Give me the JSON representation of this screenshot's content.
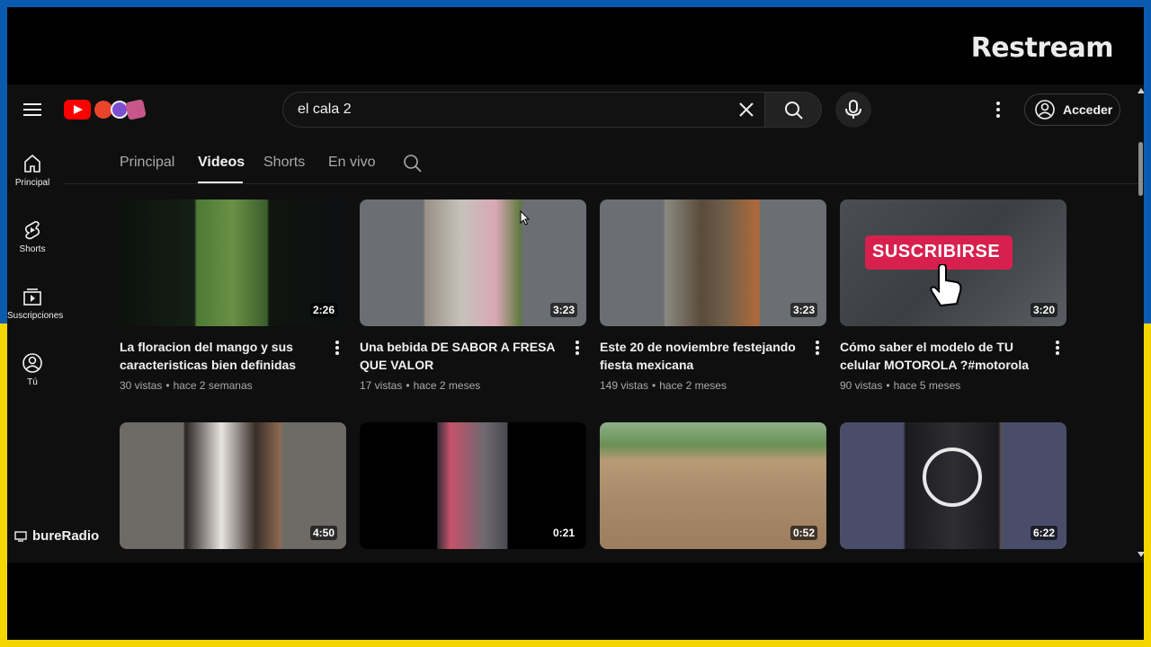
{
  "branding": {
    "restream": "Restream",
    "channel_watermark": "bureRadio"
  },
  "header": {
    "search_query": "el cala 2",
    "signin_label": "Acceder"
  },
  "sidebar": {
    "items": [
      {
        "label": "Principal",
        "icon": "home-icon"
      },
      {
        "label": "Shorts",
        "icon": "shorts-icon"
      },
      {
        "label": "Suscripciones",
        "icon": "subscriptions-icon"
      },
      {
        "label": "Tú",
        "icon": "user-circle-icon"
      }
    ]
  },
  "tabs": [
    {
      "label": "Principal",
      "active": false
    },
    {
      "label": "Videos",
      "active": true
    },
    {
      "label": "Shorts",
      "active": false
    },
    {
      "label": "En vivo",
      "active": false
    }
  ],
  "videos": [
    {
      "title": "La floracion del mango y sus caracteristicas bien definidas",
      "views": "30 vistas",
      "age": "hace 2 semanas",
      "duration": "2:26"
    },
    {
      "title": "Una bebida DE SABOR A FRESA QUE VALOR",
      "views": "17 vistas",
      "age": "hace 2 meses",
      "duration": "3:23"
    },
    {
      "title": "Este 20 de noviembre festejando fiesta mexicana",
      "views": "149 vistas",
      "age": "hace 2 meses",
      "duration": "3:23"
    },
    {
      "title": "Cómo saber el modelo de TU celular MOTOROLA ?#motorola",
      "views": "90 vistas",
      "age": "hace 5 meses",
      "duration": "3:20",
      "overlay": "SUSCRIBIRSE"
    },
    {
      "duration": "4:50"
    },
    {
      "duration": "0:21"
    },
    {
      "duration": "0:52"
    },
    {
      "duration": "6:22"
    }
  ],
  "colors": {
    "frame_top": "#0a5bb0",
    "frame_bottom": "#f3d600",
    "background": "#0f0f0f",
    "youtube_red": "#ff0000",
    "subscribe_pink": "#d8204e"
  }
}
